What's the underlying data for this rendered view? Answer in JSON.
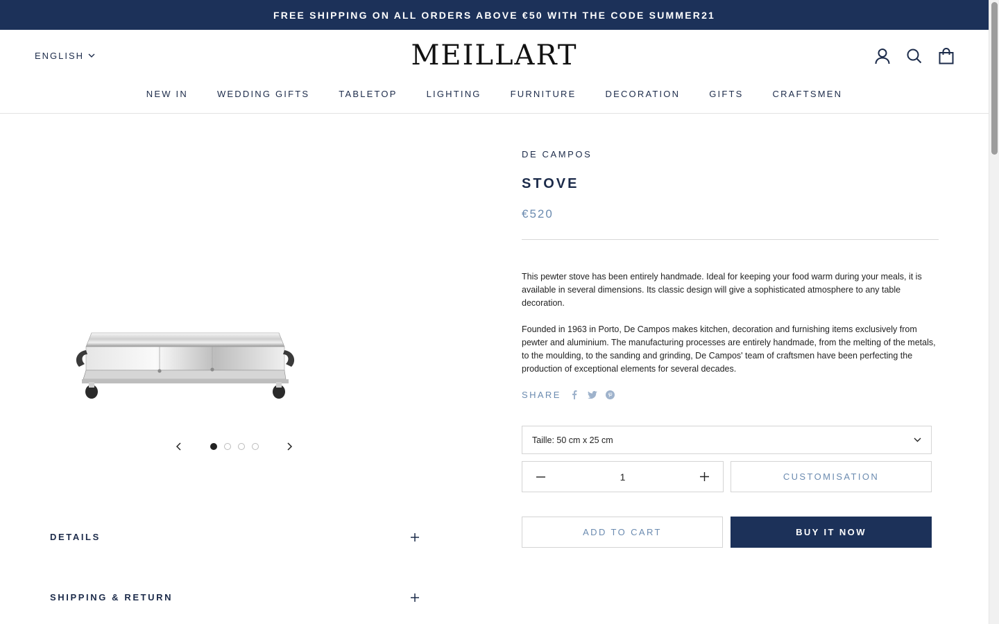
{
  "announcement": {
    "text": "FREE SHIPPING ON ALL ORDERS ABOVE €50 WITH THE CODE SUMMER21"
  },
  "header": {
    "language": "ENGLISH",
    "logo": "MEILLART",
    "icons": [
      "account-icon",
      "search-icon",
      "cart-icon"
    ]
  },
  "nav": {
    "items": [
      {
        "label": "NEW IN"
      },
      {
        "label": "WEDDING GIFTS"
      },
      {
        "label": "TABLETOP"
      },
      {
        "label": "LIGHTING"
      },
      {
        "label": "FURNITURE"
      },
      {
        "label": "DECORATION"
      },
      {
        "label": "GIFTS"
      },
      {
        "label": "CRAFTSMEN"
      }
    ]
  },
  "gallery": {
    "slide_count": 4,
    "active_slide": 1
  },
  "accordions": [
    {
      "title": "DETAILS"
    },
    {
      "title": "SHIPPING & RETURN"
    }
  ],
  "product": {
    "vendor": "DE CAMPOS",
    "title": "STOVE",
    "price": "€520",
    "description": [
      "This pewter stove has been entirely handmade. Ideal for keeping your food warm during your meals, it is available in several dimensions. Its classic design will give a sophisticated atmosphere to any table decoration.",
      "Founded in 1963 in Porto, De Campos makes kitchen, decoration and furnishing items exclusively from pewter and aluminium. The manufacturing processes are entirely handmade, from the melting of the metals, to the moulding, to the sanding and grinding, De Campos' team of craftsmen have been perfecting the production of exceptional elements for several decades."
    ],
    "share_label": "SHARE",
    "size_select": "Taille: 50 cm x 25 cm",
    "quantity": "1",
    "customisation_label": "CUSTOMISATION",
    "add_to_cart_label": "ADD TO CART",
    "buy_now_label": "BUY IT NOW"
  },
  "colors": {
    "navy": "#1c3159",
    "price_blue": "#6b8bb0"
  }
}
